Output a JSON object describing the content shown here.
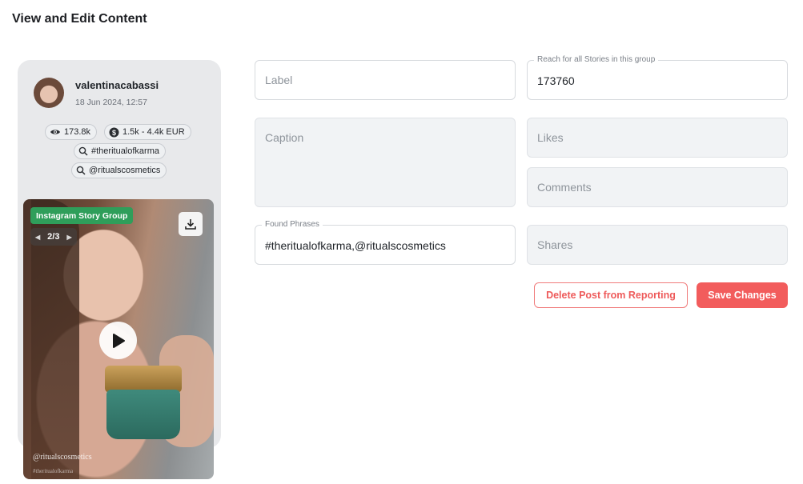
{
  "page": {
    "title": "View and Edit Content"
  },
  "post": {
    "username": "valentinacabassi",
    "date": "18 Jun 2024, 12:57",
    "views": "173.8k",
    "value_range": "1.5k - 4.4k EUR",
    "found_tags": [
      "#theritualofkarma",
      "@ritualscosmetics"
    ],
    "badge": "Instagram Story Group",
    "pager": "2/3",
    "watermark": "@ritualscosmetics",
    "watermark_small": "#theritualofkarma"
  },
  "form": {
    "label": {
      "placeholder": "Label",
      "value": ""
    },
    "reach": {
      "label": "Reach for all Stories in this group",
      "value": "173760"
    },
    "caption": {
      "placeholder": "Caption",
      "value": ""
    },
    "likes": {
      "placeholder": "Likes"
    },
    "comments": {
      "placeholder": "Comments"
    },
    "found_phrases": {
      "label": "Found Phrases",
      "value": "#theritualofkarma,@ritualscosmetics"
    },
    "shares": {
      "placeholder": "Shares"
    }
  },
  "actions": {
    "delete_label": "Delete Post from Reporting",
    "save_label": "Save Changes"
  },
  "colors": {
    "accent": "#f25c5c",
    "badge_green": "#2f9e5a"
  },
  "icons": [
    "eye-icon",
    "dollar-icon",
    "search-icon",
    "download-icon",
    "play-icon",
    "chevron-left-icon",
    "chevron-right-icon"
  ]
}
